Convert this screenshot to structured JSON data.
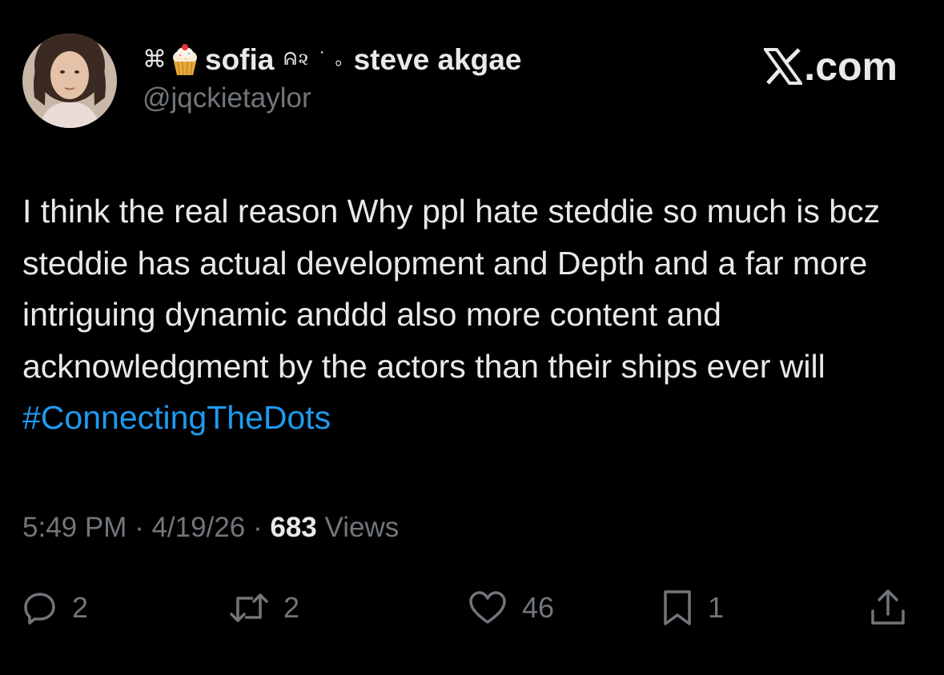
{
  "author": {
    "display_name_prefix_symbol": "⌘",
    "display_name_emoji_icon": "cupcake-icon",
    "display_name_main": "sofia",
    "display_name_deco": "ᕱ૨ ˙ ｡",
    "display_name_suffix": "steve akgae",
    "handle": "@jqckietaylor"
  },
  "site": {
    "label": ".com",
    "logo_icon": "x-logo-icon"
  },
  "tweet": {
    "text_main": "I think the real reason Why ppl hate steddie so much is bcz steddie has actual development and Depth and a far more intriguing dynamic anddd also more content and acknowledgment by the actors than their ships ever will ",
    "hashtag": "#ConnectingTheDots"
  },
  "meta": {
    "time": "5:49 PM",
    "sep1": " · ",
    "date": "4/19/26",
    "sep2": " · ",
    "views_count": "683",
    "views_label": " Views"
  },
  "actions": {
    "reply": {
      "icon": "reply-icon",
      "count": "2"
    },
    "repost": {
      "icon": "repost-icon",
      "count": "2"
    },
    "like": {
      "icon": "heart-icon",
      "count": "46"
    },
    "bookmark": {
      "icon": "bookmark-icon",
      "count": "1"
    },
    "share": {
      "icon": "share-icon"
    }
  },
  "colors": {
    "background": "#000000",
    "text_primary": "#e7e9ea",
    "text_secondary": "#71767b",
    "link": "#1d9bf0"
  }
}
